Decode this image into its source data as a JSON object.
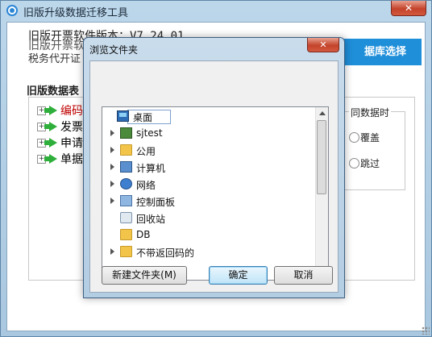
{
  "main_window": {
    "title": "旧版升级数据迁移工具",
    "close_glyph": "✕",
    "version_line1": "旧版开票软件版本：V7.24.01",
    "version_line2": "旧版开票软",
    "version_line3": "税务代开证",
    "db_select_button": "据库选择",
    "section_label": "旧版数据表",
    "tree_items": [
      {
        "expander": "+",
        "label": "编码",
        "color": "#c00000"
      },
      {
        "expander": "+",
        "label": "发票"
      },
      {
        "expander": "+",
        "label": "申请"
      },
      {
        "expander": "+",
        "label": "单据"
      }
    ],
    "option_group_title": "同数据时",
    "options": [
      "覆盖",
      "跳过"
    ]
  },
  "dialog": {
    "title": "浏览文件夹",
    "close_glyph": "✕",
    "folders": [
      {
        "label": "桌面",
        "icon": "desktop-icon",
        "selected": true,
        "expandable": false
      },
      {
        "label": "sjtest",
        "icon": "user-folder-icon",
        "expandable": true
      },
      {
        "label": "公用",
        "icon": "folder-icon",
        "expandable": true
      },
      {
        "label": "计算机",
        "icon": "computer-icon",
        "expandable": true
      },
      {
        "label": "网络",
        "icon": "network-icon",
        "expandable": true
      },
      {
        "label": "控制面板",
        "icon": "control-panel-icon",
        "expandable": true
      },
      {
        "label": "回收站",
        "icon": "recycle-bin-icon",
        "expandable": false
      },
      {
        "label": "DB",
        "icon": "folder-icon",
        "expandable": false
      },
      {
        "label": "不带返回码的",
        "icon": "folder-icon",
        "expandable": true
      }
    ],
    "new_folder_button": "新建文件夹(M)",
    "ok_button": "确定",
    "cancel_button": "取消"
  }
}
